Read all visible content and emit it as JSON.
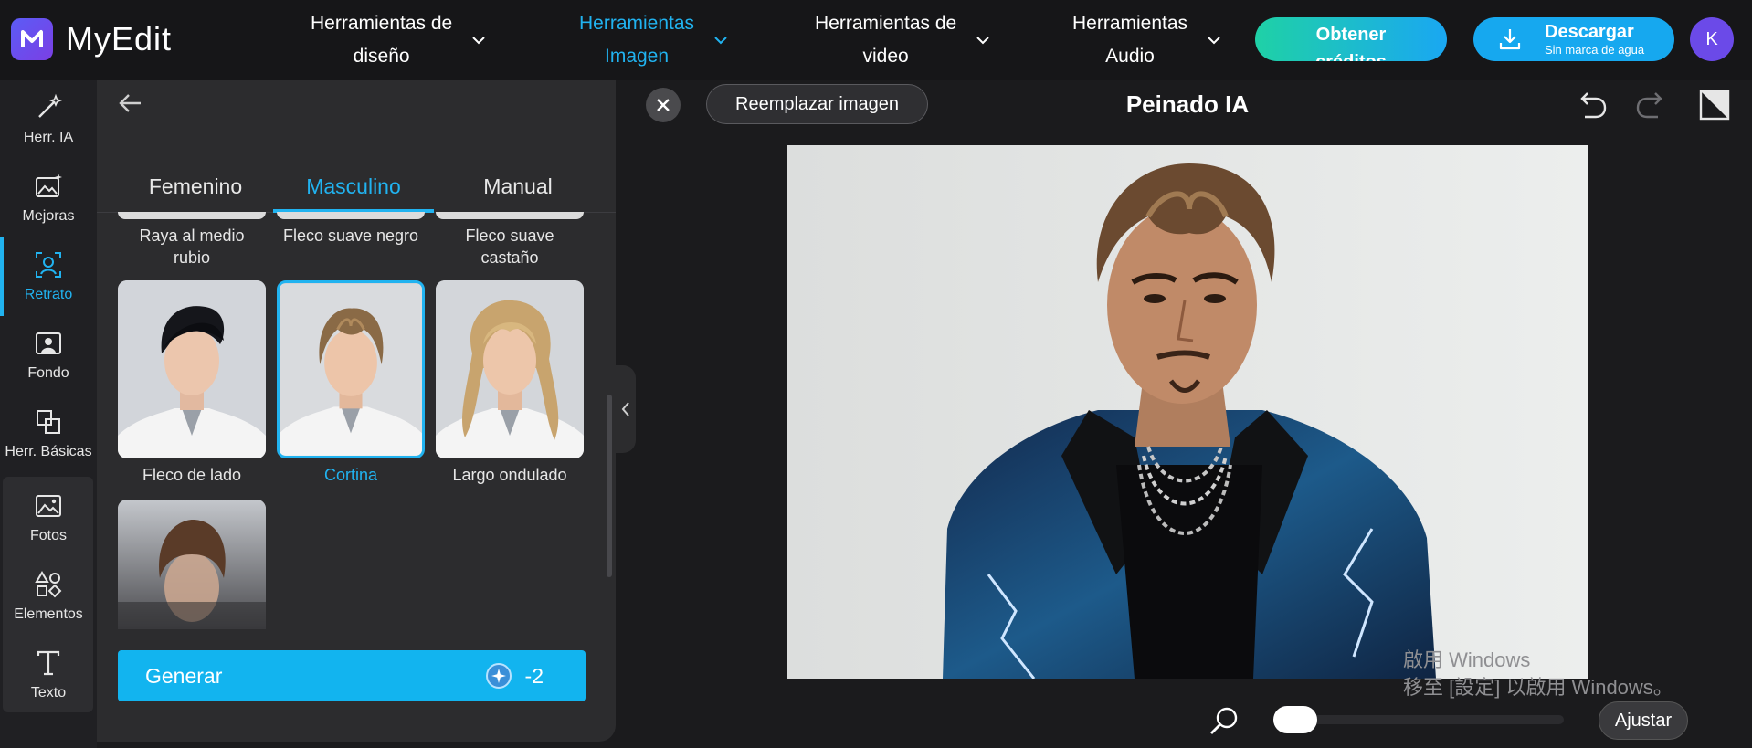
{
  "app": {
    "name": "MyEdit",
    "logo_letter": "M"
  },
  "nav": [
    {
      "line1": "Herramientas de",
      "line2": "diseño"
    },
    {
      "line1": "Herramientas",
      "line2": "Imagen"
    },
    {
      "line1": "Herramientas de",
      "line2": "video"
    },
    {
      "line1": "Herramientas",
      "line2": "Audio"
    }
  ],
  "credits_button": {
    "line1": "Obtener",
    "line2": "créditos"
  },
  "download_button": {
    "label": "Descargar",
    "sublabel": "Sin marca de agua"
  },
  "user": {
    "initial": "K"
  },
  "rail": [
    {
      "label": "Herr. IA",
      "icon": "magic-wand-icon"
    },
    {
      "label": "Mejoras",
      "icon": "image-sparkle-icon"
    },
    {
      "label": "Retrato",
      "icon": "portrait-icon"
    },
    {
      "label": "Fondo",
      "icon": "background-icon"
    },
    {
      "label": "Herr. Básicas",
      "icon": "crop-icon"
    },
    {
      "label": "Fotos",
      "icon": "photo-icon"
    },
    {
      "label": "Elementos",
      "icon": "shapes-icon"
    },
    {
      "label": "Texto",
      "icon": "text-icon"
    }
  ],
  "panel": {
    "tabs": [
      "Femenino",
      "Masculino",
      "Manual"
    ],
    "active_tab": "Masculino",
    "top_labels": [
      {
        "line1": "Raya al medio",
        "line2": "rubio"
      },
      {
        "line1": "Fleco suave negro",
        "line2": ""
      },
      {
        "line1": "Fleco suave",
        "line2": "castaño"
      }
    ],
    "styles": [
      "Fleco de lado",
      "Cortina",
      "Largo ondulado"
    ],
    "selected_style": "Cortina",
    "generate": {
      "label": "Generar",
      "cost": "-2"
    }
  },
  "canvas": {
    "replace_label": "Reemplazar imagen",
    "title": "Peinado IA",
    "zoom_fraction": 0.0,
    "fit_label": "Ajustar"
  },
  "watermark": {
    "line1": "啟用 Windows",
    "line2": "移至 [設定] 以啟用 Windows。"
  },
  "colors": {
    "accent": "#21b3f0",
    "background": "#1b1b1d",
    "panel": "#2c2c2e",
    "avatar": "#6b4ae8"
  }
}
